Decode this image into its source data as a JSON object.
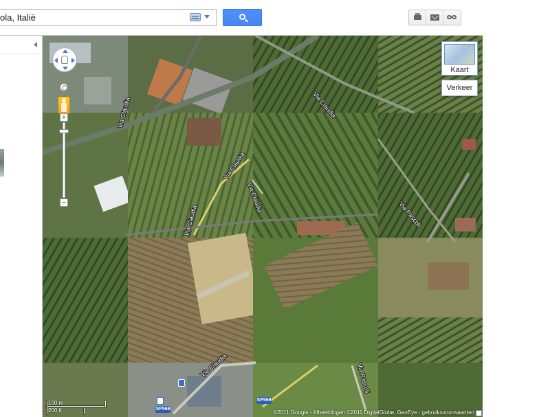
{
  "search": {
    "value": "ola, Italië"
  },
  "map": {
    "type_button_label": "Kaart",
    "traffic_button_label": "Verkeer",
    "zoom_plus": "+",
    "zoom_minus": "−",
    "scale": {
      "metric": "100 m",
      "imperial": "200 ft"
    },
    "copyright": "©2011 Google - Afbeeldingen ©2011 DigitalGlobe, GeoEye - gebruiksvoorwaarden",
    "road_labels": [
      "Via Claudia",
      "Via Claudia",
      "Via Claudia",
      "Via Claudia",
      "Via Claudia",
      "Via Pascoli",
      "Via Pascoli",
      "Via Claudia"
    ],
    "shields": [
      "SP569",
      "SP569"
    ]
  },
  "icons": {
    "keyboard": "keyboard-icon",
    "search": "search-icon",
    "print": "print-icon",
    "email": "email-icon",
    "link": "link-icon",
    "pan": "pan-control-icon",
    "pegman": "pegman-icon"
  },
  "colors": {
    "search_button": "#4d90fe",
    "aerial_green": "#5c7340"
  }
}
